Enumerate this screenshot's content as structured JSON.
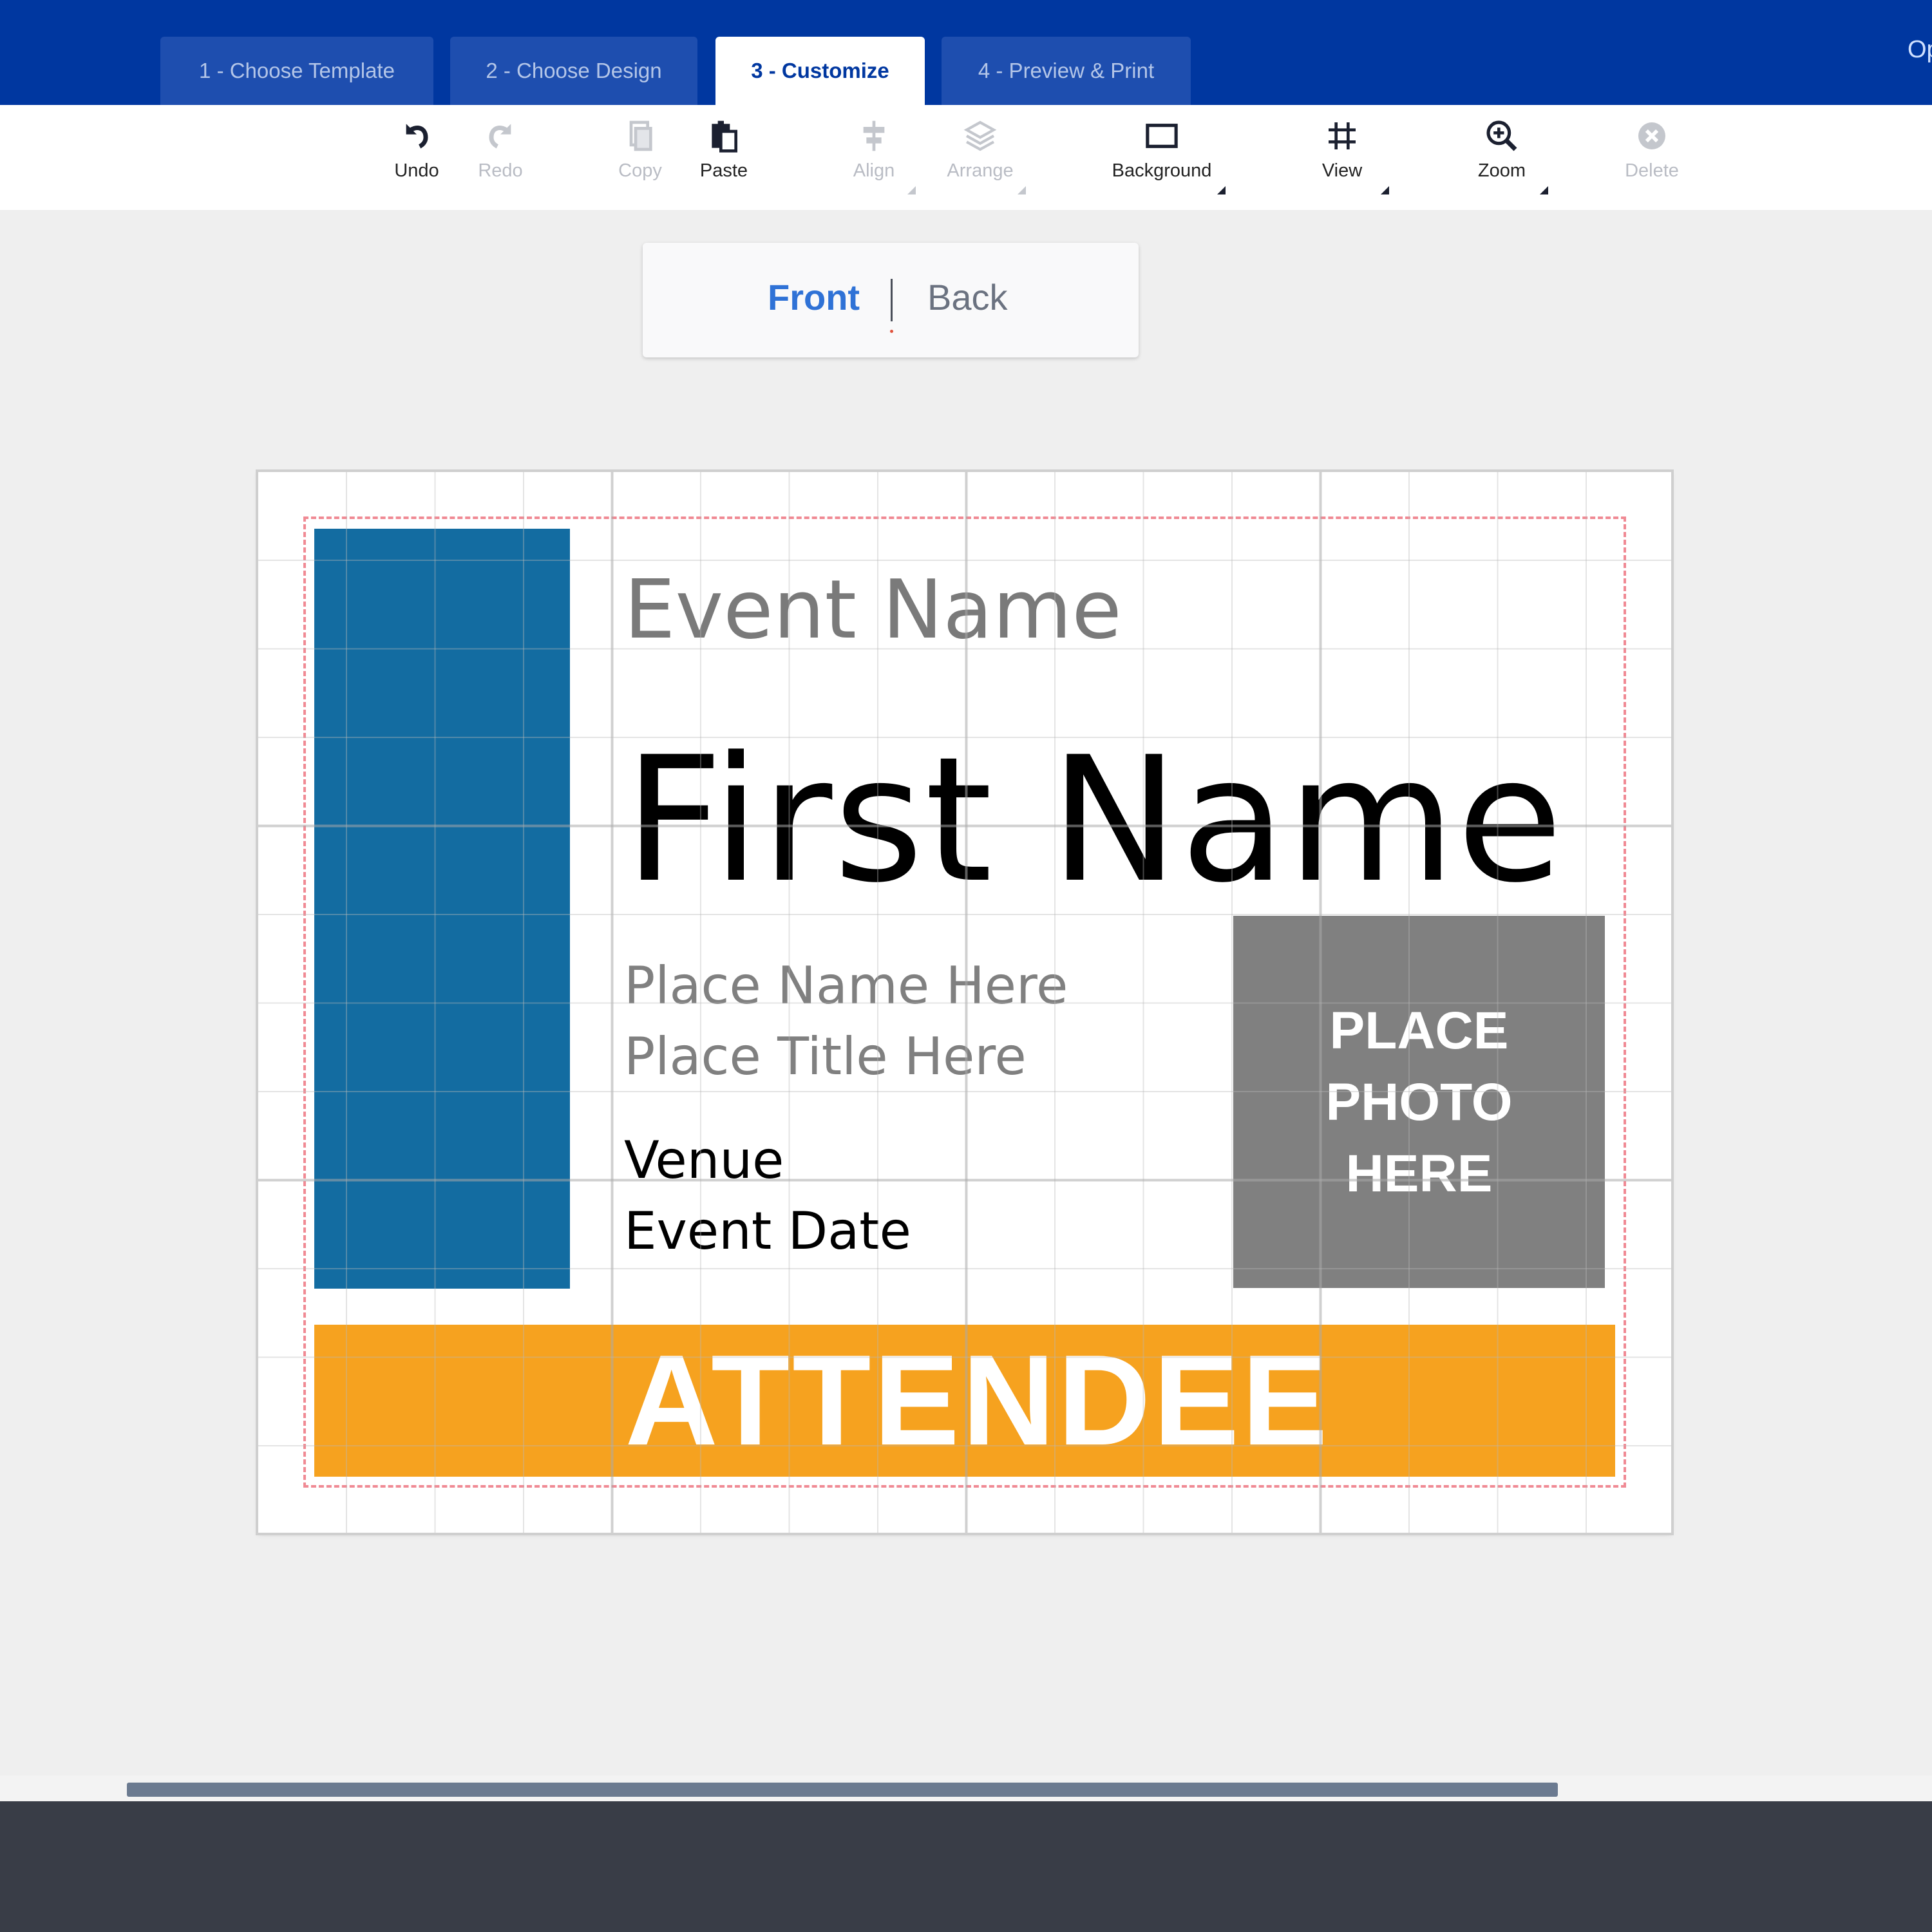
{
  "steps": [
    {
      "label": "1 - Choose Template",
      "active": false
    },
    {
      "label": "2 - Choose Design",
      "active": false
    },
    {
      "label": "3 - Customize",
      "active": true
    },
    {
      "label": "4 - Preview & Print",
      "active": false
    }
  ],
  "top_right_text": "Op",
  "toolbar": {
    "undo": "Undo",
    "redo": "Redo",
    "copy": "Copy",
    "paste": "Paste",
    "align": "Align",
    "arrange": "Arrange",
    "background": "Background",
    "view": "View",
    "zoom": "Zoom",
    "delete": "Delete"
  },
  "sides": {
    "front": "Front",
    "back": "Back",
    "active": "Front"
  },
  "badge": {
    "event_name": "Event Name",
    "first_name": "First Name",
    "place_name": "Place Name Here",
    "place_title": "Place Title Here",
    "venue": "Venue",
    "event_date": "Event Date",
    "photo_placeholder": "PLACE\nPHOTO\nHERE",
    "role": "ATTENDEE"
  },
  "colors": {
    "header": "#0037a0",
    "accent_blue": "#136ca1",
    "role_bar": "#f6a21f",
    "photo_box": "#808080",
    "footer": "#393d47"
  },
  "icons": [
    "undo-icon",
    "redo-icon",
    "copy-icon",
    "paste-icon",
    "align-icon",
    "arrange-icon",
    "background-icon",
    "grid-icon",
    "zoom-in-icon",
    "delete-icon"
  ]
}
